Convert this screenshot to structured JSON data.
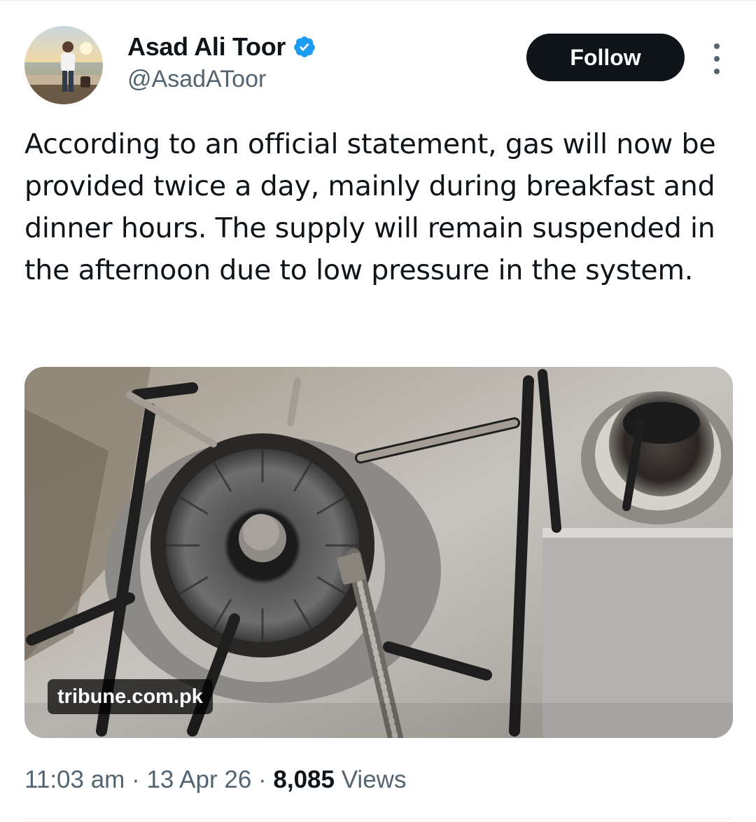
{
  "author": {
    "name": "Asad Ali Toor",
    "handle": "@AsadAToor",
    "verified": true
  },
  "actions": {
    "follow_label": "Follow",
    "more_icon": "more-vertical-icon"
  },
  "tweet": {
    "text": "According to an official statement, gas will now be provided twice a day, mainly during breakfast and dinner hours. The supply will remain suspended in the afternoon due to low pressure in the system."
  },
  "media": {
    "source_label": "tribune.com.pk"
  },
  "meta": {
    "time": "11:03 am",
    "separator": " · ",
    "date": "13 Apr 26",
    "views_count": "8,085",
    "views_label": " Views"
  },
  "colors": {
    "text_primary": "#0f1419",
    "text_secondary": "#536471",
    "verified_blue": "#1d9bf0",
    "follow_bg": "#0f1419"
  }
}
